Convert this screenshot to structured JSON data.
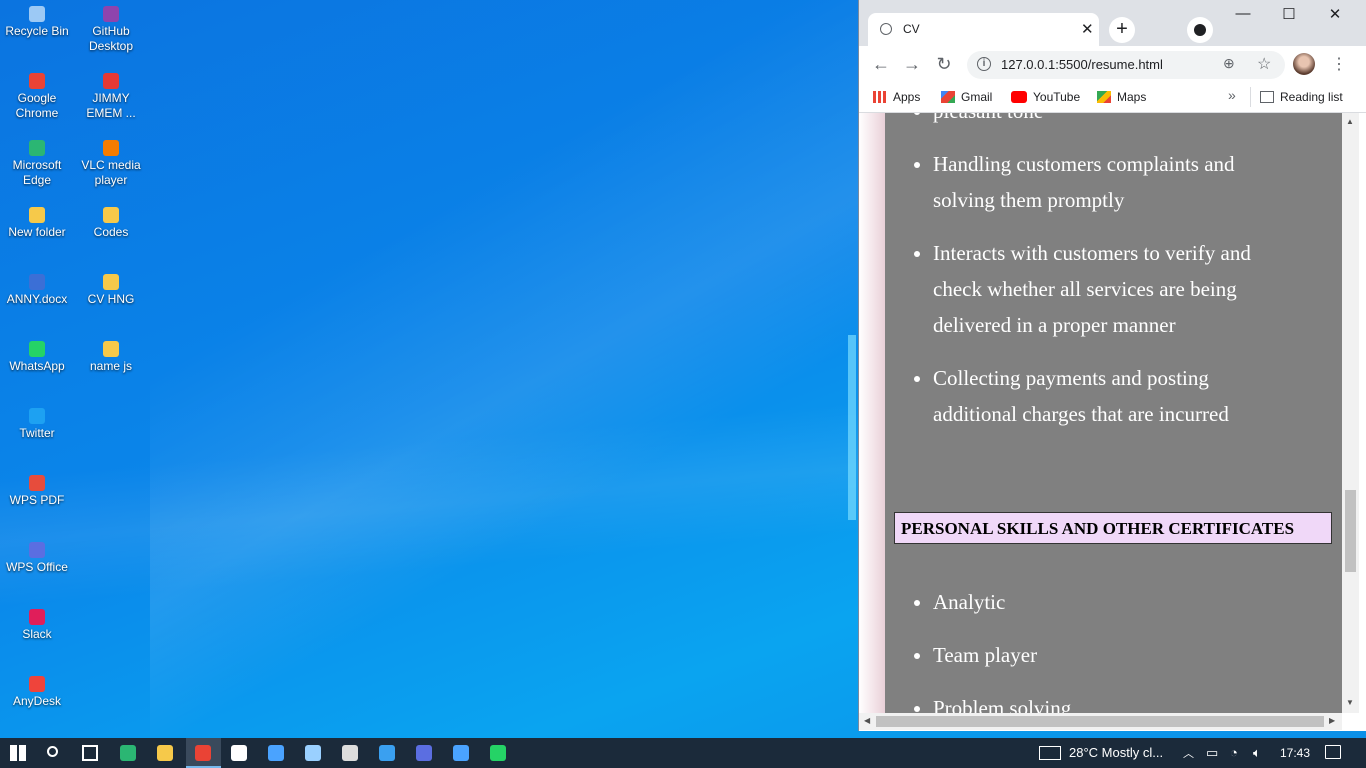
{
  "desktop": {
    "icons": [
      {
        "label": "Recycle Bin",
        "icon": "recycle-bin-icon",
        "color": "#9cc9f5"
      },
      {
        "label": "GitHub Desktop",
        "icon": "github-desktop-icon",
        "color": "#8e44ad"
      },
      {
        "label": "Google Chrome",
        "icon": "chrome-icon",
        "color": "#ea4335"
      },
      {
        "label": "JIMMY EMEM ...",
        "icon": "pdf-file-icon",
        "color": "#e53935"
      },
      {
        "label": "Microsoft Edge",
        "icon": "edge-icon",
        "color": "#2bb673"
      },
      {
        "label": "VLC media player",
        "icon": "vlc-icon",
        "color": "#f57c00"
      },
      {
        "label": "New folder",
        "icon": "folder-icon",
        "color": "#f6c94a"
      },
      {
        "label": "Codes",
        "icon": "folder-icon",
        "color": "#f6c94a"
      },
      {
        "label": "ANNY.docx",
        "icon": "word-doc-icon",
        "color": "#3b6fd6"
      },
      {
        "label": "CV HNG",
        "icon": "folder-icon",
        "color": "#f6c94a"
      },
      {
        "label": "WhatsApp",
        "icon": "whatsapp-icon",
        "color": "#25d366"
      },
      {
        "label": "name js",
        "icon": "folder-icon",
        "color": "#f6c94a"
      },
      {
        "label": "Twitter",
        "icon": "twitter-icon",
        "color": "#1da1f2"
      },
      {
        "label": "WPS PDF",
        "icon": "wps-pdf-icon",
        "color": "#e74c3c"
      },
      {
        "label": "WPS Office",
        "icon": "wps-office-icon",
        "color": "#5b6ee1"
      },
      {
        "label": "Slack",
        "icon": "slack-icon",
        "color": "#e01e5a"
      },
      {
        "label": "AnyDesk",
        "icon": "anydesk-icon",
        "color": "#ef443b"
      }
    ]
  },
  "browser": {
    "tab_title": "CV",
    "tab_close": "✕",
    "new_tab": "+",
    "window_controls": {
      "minimize": "—",
      "maximize": "☐",
      "close": "✕"
    },
    "url": "127.0.0.1:5500/resume.html",
    "bookmarks": [
      {
        "label": "Apps",
        "icon": "apps-grid-icon",
        "color": "#ea4335"
      },
      {
        "label": "Gmail",
        "icon": "gmail-icon",
        "color": "#d93025"
      },
      {
        "label": "YouTube",
        "icon": "youtube-icon",
        "color": "#ff0000"
      },
      {
        "label": "Maps",
        "icon": "maps-icon",
        "color": "#34a853"
      }
    ],
    "more_bookmarks": "»",
    "reading_list": "Reading list"
  },
  "page": {
    "partial_top_text": "pleasant tone",
    "duties": [
      "Handling customers complaints and solving them promptly",
      "Interacts with customers to verify and check whether all services are being delivered in a proper manner",
      "Collecting payments and posting additional charges that are incurred"
    ],
    "section_heading": "PERSONAL SKILLS AND OTHER CERTIFICATES",
    "skills": [
      "Analytic",
      "Team player",
      "Problem solving"
    ]
  },
  "taskbar": {
    "weather": "28°C  Mostly cl...",
    "time": "17:43",
    "apps": [
      "start-icon",
      "search-icon",
      "task-view-icon",
      "edge-icon",
      "file-explorer-icon",
      "chrome-icon",
      "store-icon",
      "mail-icon",
      "notepad-icon",
      "terminal-icon",
      "vscode-icon",
      "wps-icon",
      "photos-icon",
      "whatsapp-icon"
    ]
  }
}
